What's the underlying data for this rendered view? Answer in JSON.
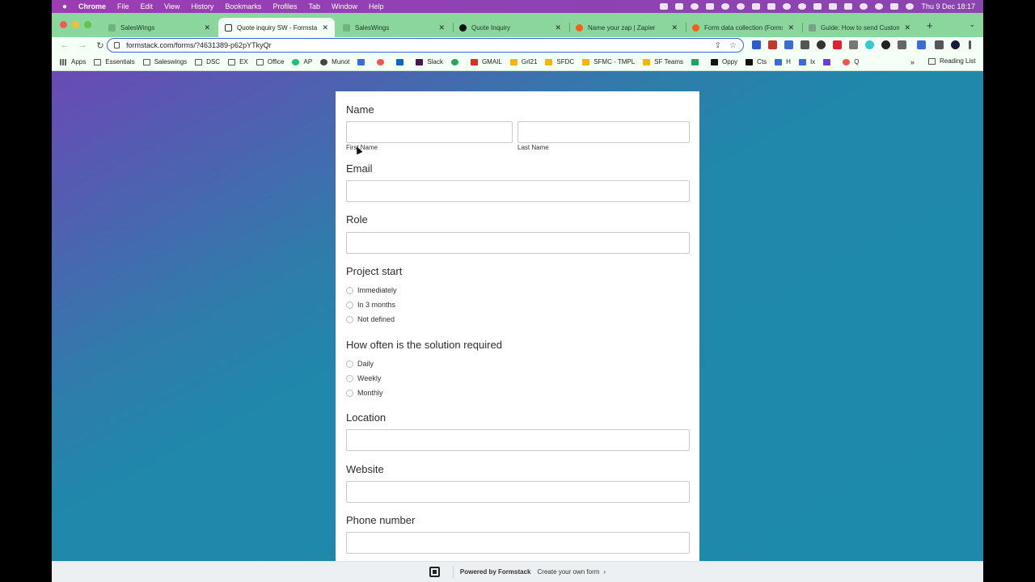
{
  "menubar": {
    "app": "Chrome",
    "items": [
      "File",
      "Edit",
      "View",
      "History",
      "Bookmarks",
      "Profiles",
      "Tab",
      "Window",
      "Help"
    ],
    "clock": "Thu 9 Dec  18:17"
  },
  "tabs": [
    {
      "label": "SalesWings",
      "active": false
    },
    {
      "label": "Quote inquiry SW - Formstack",
      "active": true
    },
    {
      "label": "SalesWings",
      "active": false
    },
    {
      "label": "Quote Inquiry",
      "active": false
    },
    {
      "label": "Name your zap | Zapier",
      "active": false
    },
    {
      "label": "Form data collection (Forms",
      "active": false
    },
    {
      "label": "Guide: How to send Custom",
      "active": false
    }
  ],
  "toolbar": {
    "url": "formstack.com/forms/?4631389-p62pYTkyQr"
  },
  "bookmarks": {
    "items": [
      "Apps",
      "Essentials",
      "Saleswings",
      "DSC",
      "EX",
      "Office",
      "AP",
      "Munot",
      "",
      "",
      "",
      "Slack",
      "",
      "GMAIL",
      "Grl21",
      "SFDC",
      "SFMC - TMPL",
      "SF Teams",
      "",
      "Oppy",
      "Cts",
      "H",
      "Ix",
      "",
      "Q"
    ],
    "more": "»",
    "reading_list": "Reading List"
  },
  "form": {
    "name_label": "Name",
    "first_name_sub": "First Name",
    "last_name_sub": "Last Name",
    "email_label": "Email",
    "role_label": "Role",
    "project_start_label": "Project start",
    "project_start_options": [
      "Immediately",
      "In 3 months",
      "Not defined"
    ],
    "frequency_label": "How often is the solution required",
    "frequency_options": [
      "Daily",
      "Weekly",
      "Monthly"
    ],
    "location_label": "Location",
    "website_label": "Website",
    "phone_label": "Phone number"
  },
  "footer": {
    "powered_by": "Powered by Formstack",
    "create_link": "Create your own form",
    "chevron": "›"
  },
  "colors": {
    "tab_strip": "#8bd69c",
    "page_bg": "#1e8aab",
    "page_bg_corner": "#6a4ab6",
    "omnibox_focus": "#3a63d8"
  }
}
